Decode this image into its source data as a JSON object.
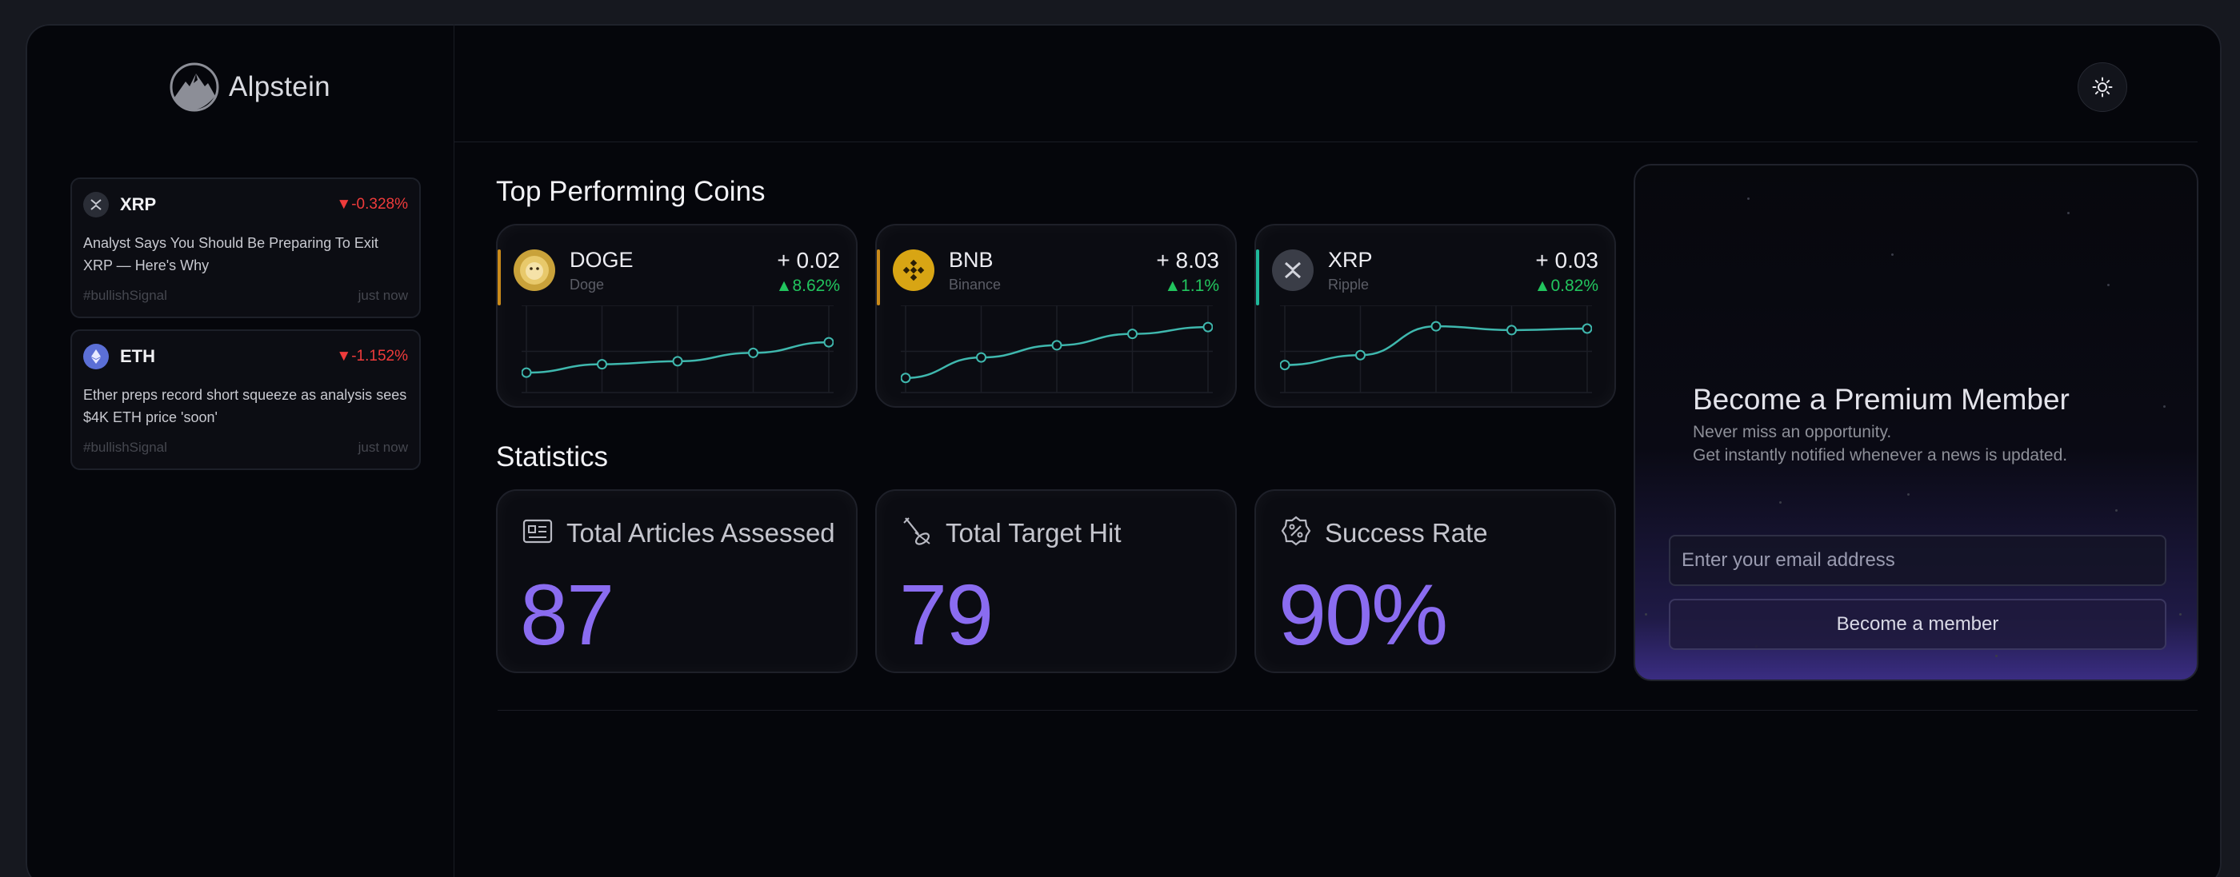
{
  "brand": {
    "name": "Alpstein",
    "logo_icon": "mountain-logo-icon"
  },
  "header": {
    "theme_toggle_icon": "sun-icon"
  },
  "news": [
    {
      "symbol": "XRP",
      "change": "▼-0.328%",
      "text": "Analyst Says You Should Be Preparing To Exit XRP — Here's Why",
      "tag": "#bullishSignal",
      "time": "just now",
      "icon": "xrp-icon",
      "color": "#2a2d36"
    },
    {
      "symbol": "ETH",
      "change": "▼-1.152%",
      "text": "Ether preps record short squeeze as analysis sees $4K ETH price 'soon'",
      "tag": "#bullishSignal",
      "time": "just now",
      "icon": "eth-icon",
      "color": "#5b6fd6"
    }
  ],
  "top_coins": {
    "title": "Top Performing Coins",
    "items": [
      {
        "symbol": "DOGE",
        "name": "Doge",
        "delta": "+ 0.02",
        "pct": "▲8.62%",
        "accent": "#c98a1a",
        "icon": "doge-icon",
        "trend": [
          0.22,
          0.33,
          0.37,
          0.48,
          0.62
        ]
      },
      {
        "symbol": "BNB",
        "name": "Binance",
        "delta": "+ 8.03",
        "pct": "▲1.1%",
        "accent": "#c98a1a",
        "icon": "bnb-icon",
        "trend": [
          0.15,
          0.42,
          0.58,
          0.73,
          0.82
        ]
      },
      {
        "symbol": "XRP",
        "name": "Ripple",
        "delta": "+ 0.03",
        "pct": "▲0.82%",
        "accent": "#1fb89a",
        "icon": "xrp-icon",
        "trend": [
          0.32,
          0.45,
          0.83,
          0.78,
          0.8
        ]
      }
    ]
  },
  "statistics": {
    "title": "Statistics",
    "items": [
      {
        "label": "Total Articles Assessed",
        "value": "87",
        "icon": "article-icon"
      },
      {
        "label": "Total Target Hit",
        "value": "79",
        "icon": "target-hit-icon"
      },
      {
        "label": "Success Rate",
        "value": "90%",
        "icon": "percent-badge-icon"
      }
    ]
  },
  "premium": {
    "title": "Become a Premium Member",
    "subtitle1": "Never miss an opportunity.",
    "subtitle2": "Get instantly notified whenever a news is updated.",
    "email_placeholder": "Enter your email address",
    "button_label": "Become a member"
  }
}
